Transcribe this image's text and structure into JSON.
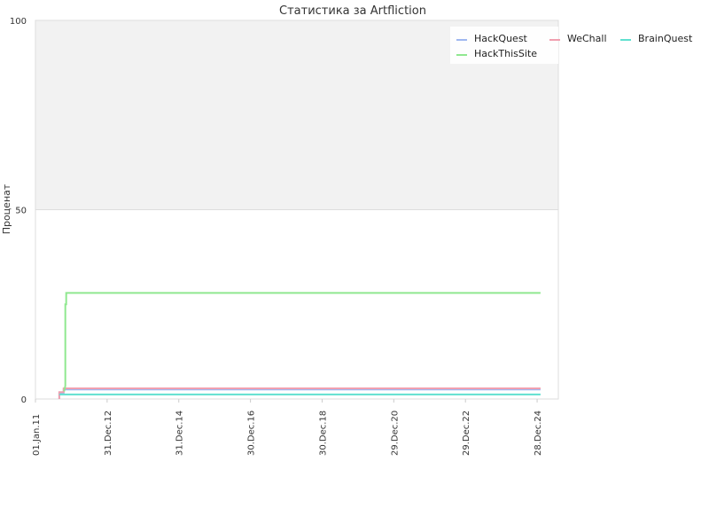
{
  "chart_data": {
    "type": "line",
    "title": "Статистика за Artfliction",
    "xlabel": "",
    "ylabel": "Проценат",
    "ylim": [
      0,
      100
    ],
    "y_ticks": [
      0,
      50,
      100
    ],
    "x_tick_labels": [
      "01.Jan.11",
      "31.Dec.12",
      "31.Dec.14",
      "30.Dec.16",
      "30.Dec.18",
      "29.Dec.20",
      "29.Dec.22",
      "28.Dec.24"
    ],
    "x_tick_dates": [
      "2011-01-01",
      "2012-12-31",
      "2014-12-31",
      "2016-12-30",
      "2018-12-30",
      "2020-12-29",
      "2022-12-29",
      "2024-12-28"
    ],
    "xlim": [
      "2011-01-01",
      "2025-08-01"
    ],
    "grid": true,
    "background_bands": [
      {
        "from": 50,
        "to": 100,
        "color": "#f2f2f2"
      }
    ],
    "legend_position": "top-right",
    "series": [
      {
        "name": "HackQuest",
        "color": "#a0b8f0",
        "points": [
          [
            "2011-09-01",
            0
          ],
          [
            "2011-09-01",
            1.5
          ],
          [
            "2011-10-15",
            1.5
          ],
          [
            "2011-10-15",
            2.5
          ],
          [
            "2025-02-01",
            2.5
          ]
        ]
      },
      {
        "name": "WeChall",
        "color": "#f0a0b0",
        "points": [
          [
            "2011-09-01",
            0
          ],
          [
            "2011-09-01",
            1.8
          ],
          [
            "2011-10-15",
            1.8
          ],
          [
            "2011-10-15",
            2.8
          ],
          [
            "2025-02-01",
            2.8
          ]
        ]
      },
      {
        "name": "BrainQuest",
        "color": "#60e0d0",
        "points": [
          [
            "2011-09-01",
            1.2
          ],
          [
            "2025-02-01",
            1.2
          ]
        ]
      },
      {
        "name": "HackThisSite",
        "color": "#90e890",
        "points": [
          [
            "2011-10-20",
            2.0
          ],
          [
            "2011-11-01",
            3.5
          ],
          [
            "2011-11-01",
            25.0
          ],
          [
            "2011-11-10",
            25.0
          ],
          [
            "2011-11-10",
            28.0
          ],
          [
            "2025-02-01",
            28.0
          ]
        ]
      }
    ],
    "legend_order": [
      "HackQuest",
      "WeChall",
      "BrainQuest",
      "HackThisSite"
    ]
  }
}
